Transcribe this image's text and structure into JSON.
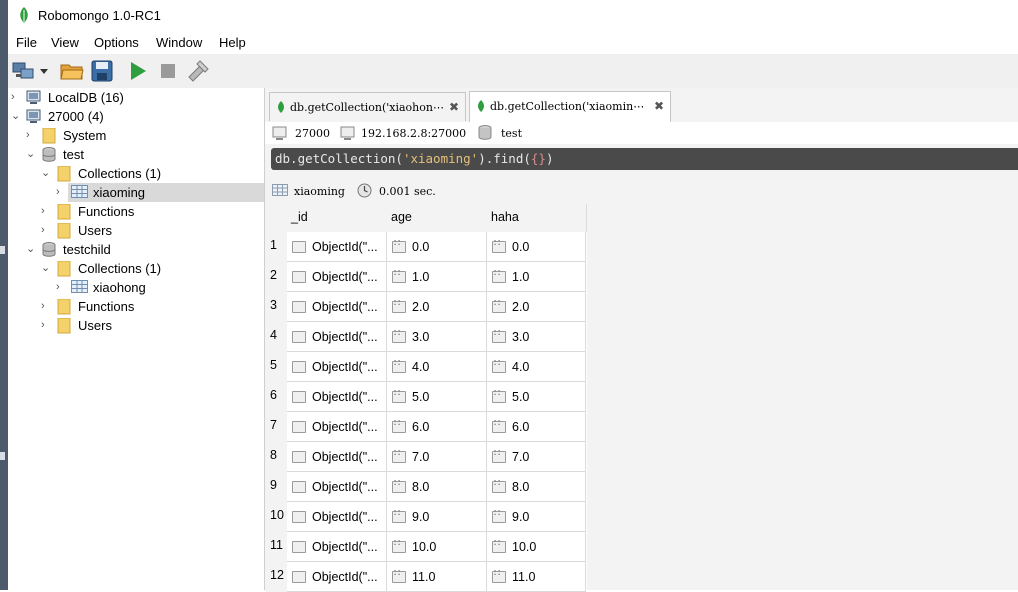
{
  "window": {
    "title": "Robomongo 1.0-RC1"
  },
  "menu": [
    "File",
    "View",
    "Options",
    "Window",
    "Help"
  ],
  "toolbar": {
    "icons": [
      "connect-icon",
      "dropdown-arrow-icon",
      "open-folder-icon",
      "save-icon",
      "execute-icon",
      "stop-icon",
      "tools-icon"
    ]
  },
  "tree": {
    "nodes": [
      {
        "label": "LocalDB (16)",
        "icon": "server-icon",
        "arrow": ">"
      },
      {
        "label": "27000 (4)",
        "icon": "server-icon",
        "arrow": "v"
      },
      {
        "label": "System",
        "icon": "folder-icon",
        "arrow": ">"
      },
      {
        "label": "test",
        "icon": "database-icon",
        "arrow": "v"
      },
      {
        "label": "Collections (1)",
        "icon": "folder-icon",
        "arrow": "v"
      },
      {
        "label": "xiaoming",
        "icon": "collection-icon",
        "arrow": ">"
      },
      {
        "label": "Functions",
        "icon": "folder-icon",
        "arrow": ">"
      },
      {
        "label": "Users",
        "icon": "folder-icon",
        "arrow": ">"
      },
      {
        "label": "testchild",
        "icon": "database-icon",
        "arrow": "v"
      },
      {
        "label": "Collections (1)",
        "icon": "folder-icon",
        "arrow": "v"
      },
      {
        "label": "xiaohong",
        "icon": "collection-icon",
        "arrow": ">"
      },
      {
        "label": "Functions",
        "icon": "folder-icon",
        "arrow": ">"
      },
      {
        "label": "Users",
        "icon": "folder-icon",
        "arrow": ">"
      }
    ]
  },
  "tabs": [
    {
      "label": "db.getCollection('xiaohon⋯",
      "active": false
    },
    {
      "label": "db.getCollection('xiaomin⋯",
      "active": true
    }
  ],
  "connection": {
    "port": "27000",
    "host": "192.168.2.8:27000",
    "db": "test"
  },
  "query": {
    "prefix": "db.getCollection(",
    "arg": "'xiaoming'",
    "suffix": ").find(",
    "braces": "{}",
    "end": ")"
  },
  "result": {
    "collection": "xiaoming",
    "time": "0.001 sec."
  },
  "columns": [
    "_id",
    "age",
    "haha"
  ],
  "rows": [
    {
      "n": "1",
      "id": "ObjectId(\"...",
      "age": "0.0",
      "haha": "0.0"
    },
    {
      "n": "2",
      "id": "ObjectId(\"...",
      "age": "1.0",
      "haha": "1.0"
    },
    {
      "n": "3",
      "id": "ObjectId(\"...",
      "age": "2.0",
      "haha": "2.0"
    },
    {
      "n": "4",
      "id": "ObjectId(\"...",
      "age": "3.0",
      "haha": "3.0"
    },
    {
      "n": "5",
      "id": "ObjectId(\"...",
      "age": "4.0",
      "haha": "4.0"
    },
    {
      "n": "6",
      "id": "ObjectId(\"...",
      "age": "5.0",
      "haha": "5.0"
    },
    {
      "n": "7",
      "id": "ObjectId(\"...",
      "age": "6.0",
      "haha": "6.0"
    },
    {
      "n": "8",
      "id": "ObjectId(\"...",
      "age": "7.0",
      "haha": "7.0"
    },
    {
      "n": "9",
      "id": "ObjectId(\"...",
      "age": "8.0",
      "haha": "8.0"
    },
    {
      "n": "10",
      "id": "ObjectId(\"...",
      "age": "9.0",
      "haha": "9.0"
    },
    {
      "n": "11",
      "id": "ObjectId(\"...",
      "age": "10.0",
      "haha": "10.0"
    },
    {
      "n": "12",
      "id": "ObjectId(\"...",
      "age": "11.0",
      "haha": "11.0"
    }
  ],
  "colors": {
    "accent_green": "#2e9e3e",
    "query_bg": "#4a4a4a",
    "string": "#e5c07b",
    "folder": "#f5d16b"
  }
}
